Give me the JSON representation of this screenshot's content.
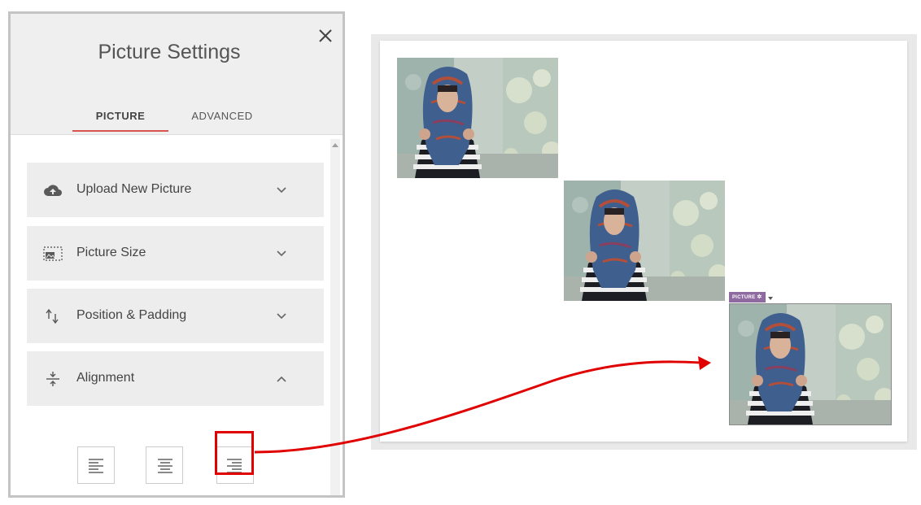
{
  "panel": {
    "title": "Picture Settings",
    "tabs": [
      {
        "label": "PICTURE",
        "active": true
      },
      {
        "label": "ADVANCED",
        "active": false
      }
    ],
    "sections": [
      {
        "label": "Upload New Picture",
        "icon": "cloud-upload-icon",
        "expanded": false
      },
      {
        "label": "Picture Size",
        "icon": "picture-size-icon",
        "expanded": false
      },
      {
        "label": "Position & Padding",
        "icon": "position-arrows-icon",
        "expanded": false
      },
      {
        "label": "Alignment",
        "icon": "alignment-icon",
        "expanded": true
      }
    ],
    "alignment_options": [
      "align-left",
      "align-center",
      "align-right"
    ],
    "selected_alignment": "align-right"
  },
  "preview": {
    "badge_label": "PICTURE",
    "images": [
      "left-aligned",
      "center-aligned",
      "right-aligned"
    ],
    "selected_image": "right-aligned"
  },
  "colors": {
    "accent_tab": "#d9534f",
    "highlight": "#e00000",
    "badge": "#8e6aa0"
  }
}
